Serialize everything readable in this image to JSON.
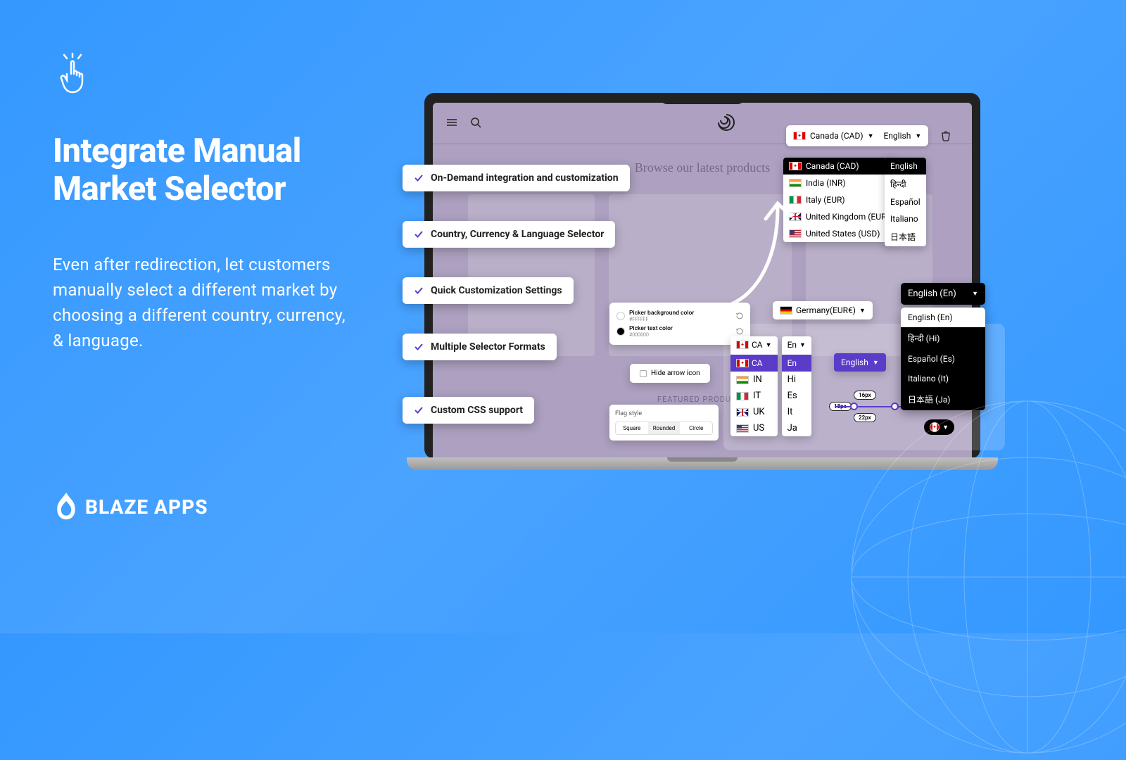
{
  "headline_line1": "Integrate Manual",
  "headline_line2": "Market Selector",
  "description": "Even after redirection, let customers manually select a different market by choosing a different country, currency, & language.",
  "brand": "BLAZE APPS",
  "features": [
    "On-Demand integration and customization",
    "Country, Currency & Language Selector",
    "Quick Customization Settings",
    "Multiple Selector Formats",
    "Custom CSS support"
  ],
  "screen": {
    "hero": "Browse our latest products",
    "featured": "FEATURED PRODUCTS"
  },
  "topSelector": {
    "country": "Canada (CAD)",
    "language": "English"
  },
  "countryDropdown": [
    {
      "flag": "ca",
      "label": "Canada (CAD)"
    },
    {
      "flag": "in",
      "label": "India (INR)"
    },
    {
      "flag": "it",
      "label": "Italy (EUR)"
    },
    {
      "flag": "uk",
      "label": "United Kingdom (EUR)"
    },
    {
      "flag": "us",
      "label": "United States (USD)"
    }
  ],
  "langDropdown": [
    "English",
    "हिन्दी",
    "Español",
    "Italiano",
    "日本語"
  ],
  "colorCard": {
    "bgLabel": "Picker background color",
    "bgHex": "#FFFFFF",
    "textLabel": "Picker text color",
    "textHex": "#000000"
  },
  "hideArrowLabel": "Hide arrow icon",
  "flagStyle": {
    "title": "Flag style",
    "options": [
      "Square",
      "Rounded",
      "Circle"
    ]
  },
  "germanyLabel": "Germany(EUR€)",
  "compactCountryHead": "CA",
  "compactCountry": [
    {
      "flag": "ca",
      "label": "CA"
    },
    {
      "flag": "in",
      "label": "IN"
    },
    {
      "flag": "it",
      "label": "IT"
    },
    {
      "flag": "uk",
      "label": "UK"
    },
    {
      "flag": "us",
      "label": "US"
    }
  ],
  "compactLangHead": "En",
  "compactLang": [
    "En",
    "Hi",
    "Es",
    "It",
    "Ja"
  ],
  "engPurple": "English",
  "sizes": {
    "a": "16px",
    "b": "18px",
    "c": "22px"
  },
  "langBlack": {
    "head": "English (En)",
    "items": [
      "English (En)",
      "हिन्दी (Hi)",
      "Español (Es)",
      "Italiano (It)",
      "日本語 (Ja)"
    ]
  }
}
